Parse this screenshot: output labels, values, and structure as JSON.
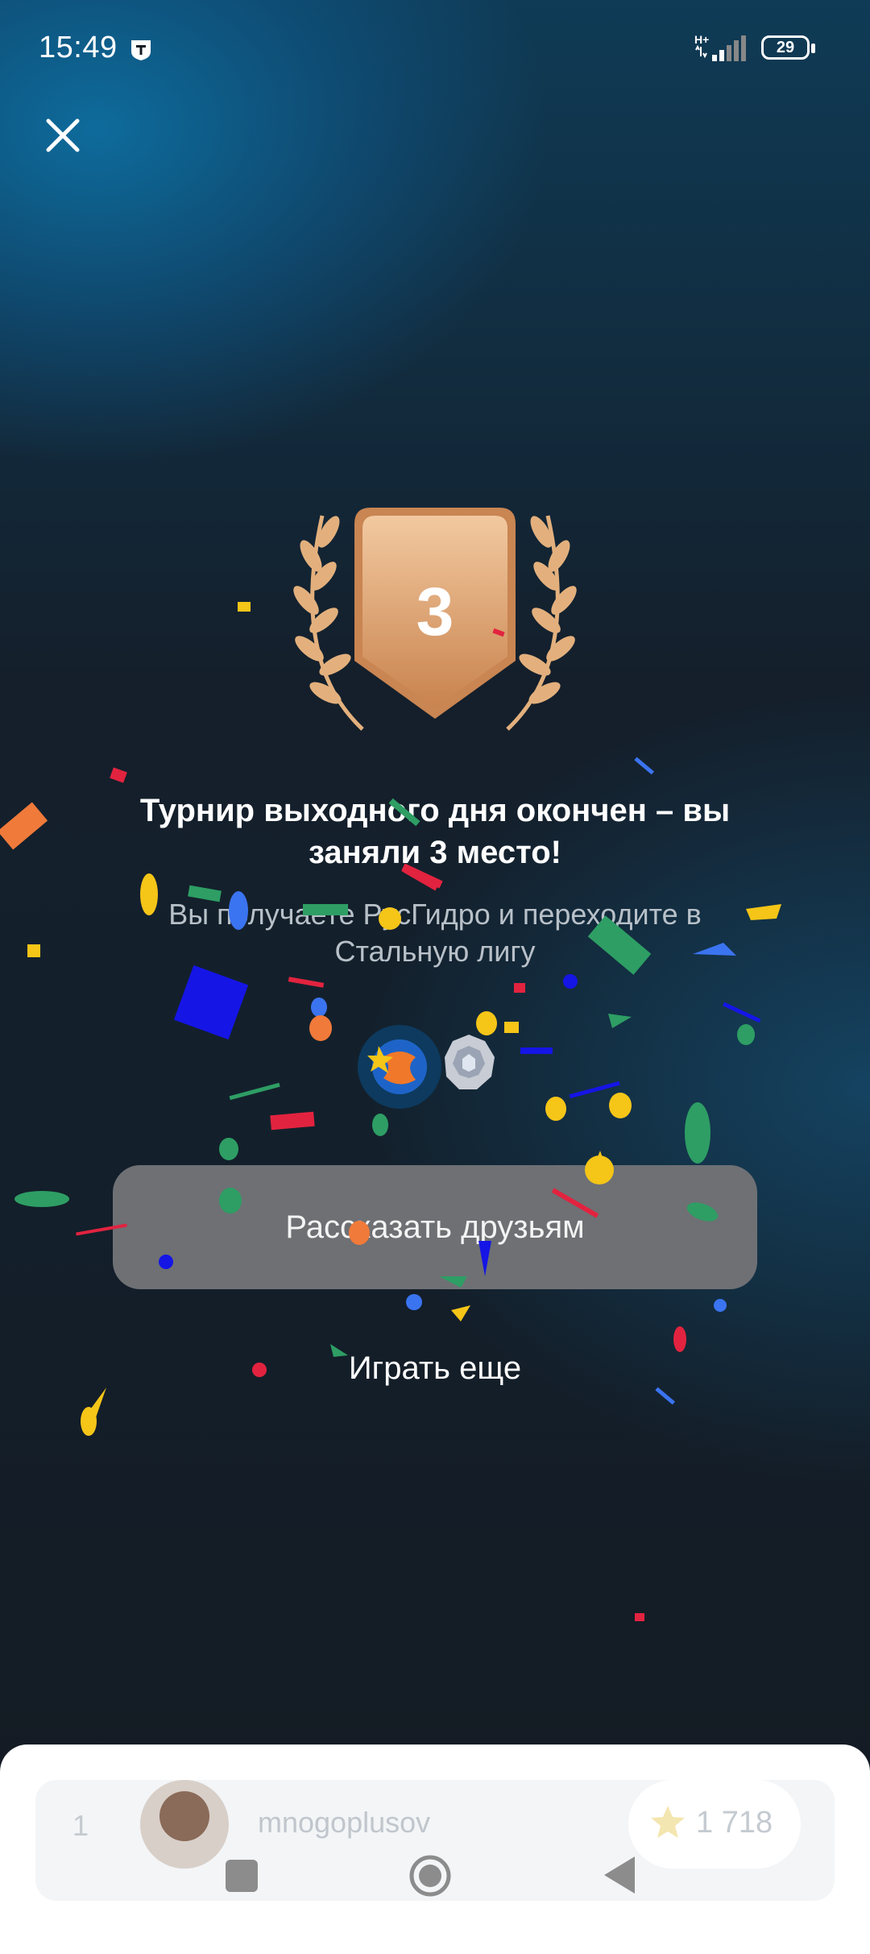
{
  "status_bar": {
    "time": "15:49",
    "network": "H+",
    "battery": "29"
  },
  "badge": {
    "place_number": "3"
  },
  "result": {
    "title": "Турнир выходного дня окончен – вы заняли 3 место!",
    "subtitle": "Вы получаете РусГидро и переходите в Стальную лигу"
  },
  "actions": {
    "share_label": "Рассказать друзьям",
    "play_again_label": "Играть еще"
  },
  "leaderboard": {
    "rows": [
      {
        "rank": "1",
        "username": "mnogoplusov",
        "score": "1 718"
      }
    ]
  },
  "colors": {
    "share_button": "#6e7074",
    "badge_bronze": "#d99a65",
    "laurel": "#e3b07d",
    "background": "#141a22"
  },
  "icons": {
    "close": "close-icon",
    "star": "star-icon",
    "laurel": "laurel-icon",
    "league": "steel-league-icon",
    "reward": "rushydro-reward-icon"
  }
}
